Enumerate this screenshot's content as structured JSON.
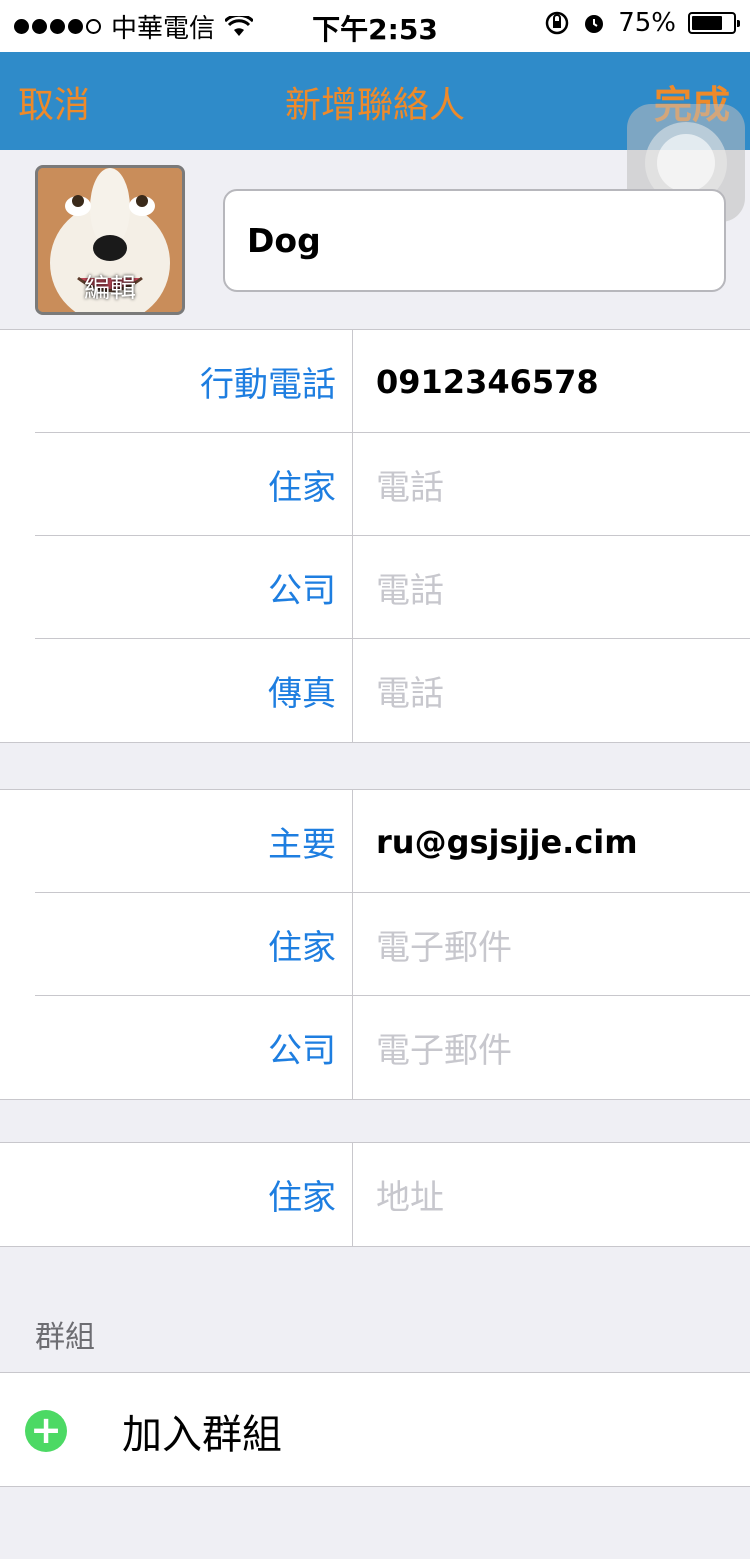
{
  "status_bar": {
    "carrier": "中華電信",
    "time": "下午2:53",
    "battery": "75%",
    "battery_level": 0.75,
    "icons": [
      "signal-dots",
      "wifi-icon",
      "rotation-lock-icon",
      "alarm-icon",
      "battery-icon"
    ]
  },
  "nav": {
    "cancel_label": "取消",
    "title": "新增聯絡人",
    "done_label": "完成"
  },
  "contact": {
    "photo_edit_label": "編輯",
    "name_value": "Dog"
  },
  "phones": [
    {
      "label": "行動電話",
      "value": "0912346578",
      "placeholder": ""
    },
    {
      "label": "住家",
      "value": "",
      "placeholder": "電話"
    },
    {
      "label": "公司",
      "value": "",
      "placeholder": "電話"
    },
    {
      "label": "傳真",
      "value": "",
      "placeholder": "電話"
    }
  ],
  "emails": [
    {
      "label": "主要",
      "value": "ru@gsjsjje.cim",
      "placeholder": ""
    },
    {
      "label": "住家",
      "value": "",
      "placeholder": "電子郵件"
    },
    {
      "label": "公司",
      "value": "",
      "placeholder": "電子郵件"
    }
  ],
  "addresses": [
    {
      "label": "住家",
      "value": "",
      "placeholder": "地址"
    }
  ],
  "groups": {
    "header": "群組",
    "add_label": "加入群組"
  },
  "colors": {
    "nav_background": "#2f8bc9",
    "nav_text": "#ee8a2a",
    "label_blue": "#1e7ee0",
    "add_green": "#4cd964",
    "placeholder": "#c7c7cd"
  }
}
